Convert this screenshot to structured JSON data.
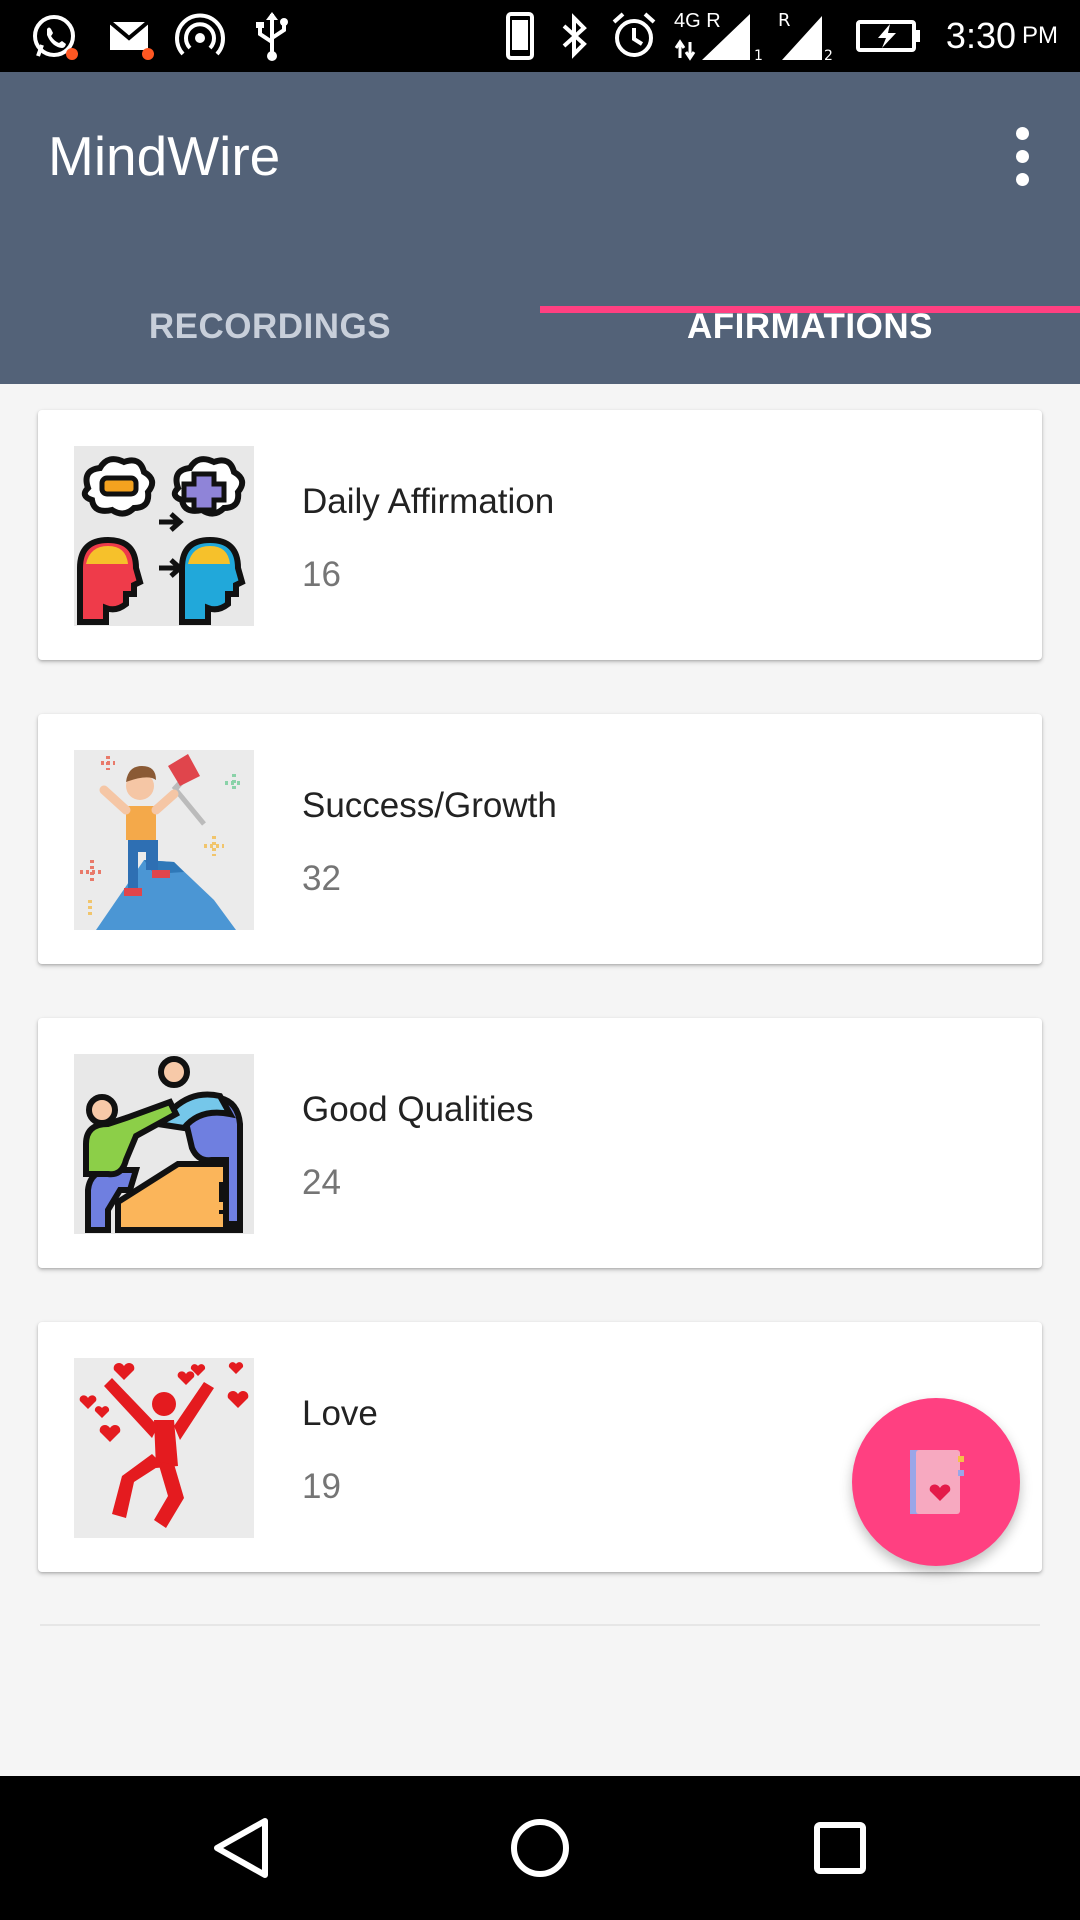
{
  "status_bar": {
    "time": "3:30",
    "ampm": "PM",
    "network_label": "4G R",
    "icons": [
      "whatsapp-icon",
      "gmail-icon",
      "hotspot-icon",
      "usb-icon",
      "phone-icon",
      "bluetooth-icon",
      "alarm-icon",
      "signal-sim1-icon",
      "signal-sim2-icon",
      "battery-charging-icon"
    ]
  },
  "app_bar": {
    "title": "MindWire",
    "menu_icon": "more-vert-icon"
  },
  "tabs": [
    {
      "label": "RECORDINGS",
      "selected": false
    },
    {
      "label": "AFIRMATIONS",
      "selected": true
    }
  ],
  "colors": {
    "app_bar": "#536278",
    "accent": "#ff4081",
    "background": "#f5f5f5"
  },
  "categories": [
    {
      "title": "Daily Affirmation",
      "count": "16",
      "icon": "mindset-change-icon"
    },
    {
      "title": "Success/Growth",
      "count": "32",
      "icon": "summit-flag-icon"
    },
    {
      "title": "Good Qualities",
      "count": "24",
      "icon": "helping-hand-icon"
    },
    {
      "title": "Love",
      "count": "19",
      "icon": "love-jump-icon"
    }
  ],
  "fab": {
    "icon": "love-journal-icon"
  },
  "nav_bar": {
    "icons": [
      "back-icon",
      "home-icon",
      "recents-icon"
    ]
  }
}
